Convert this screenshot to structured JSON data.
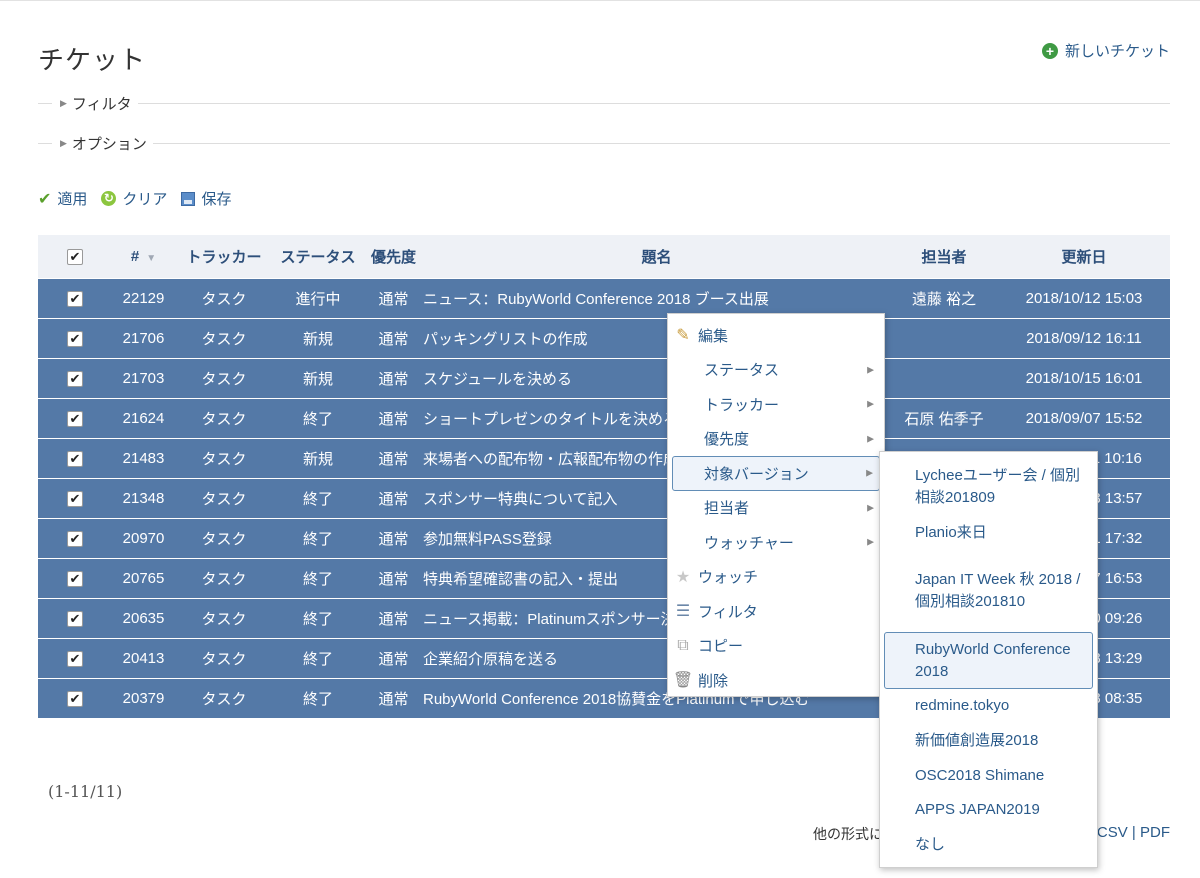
{
  "page": {
    "title": "チケット",
    "new_issue": "新しいチケット",
    "filter_label": "フィルタ",
    "options_label": "オプション"
  },
  "actions": {
    "apply": "適用",
    "clear": "クリア",
    "save": "保存"
  },
  "table": {
    "headers": [
      "#",
      "トラッカー",
      "ステータス",
      "優先度",
      "題名",
      "担当者",
      "更新日"
    ],
    "rows": [
      {
        "id": "22129",
        "tracker": "タスク",
        "status": "進行中",
        "priority": "通常",
        "subject": "ニュース：RubyWorld Conference 2018 ブース出展",
        "assignee": "遠藤 裕之",
        "updated": "2018/10/12 15:03"
      },
      {
        "id": "21706",
        "tracker": "タスク",
        "status": "新規",
        "priority": "通常",
        "subject": "パッキングリストの作成",
        "assignee": "",
        "updated": "2018/09/12 16:11"
      },
      {
        "id": "21703",
        "tracker": "タスク",
        "status": "新規",
        "priority": "通常",
        "subject": "スケジュールを決める",
        "assignee": "",
        "updated": "2018/10/15 16:01"
      },
      {
        "id": "21624",
        "tracker": "タスク",
        "status": "終了",
        "priority": "通常",
        "subject": "ショートプレゼンのタイトルを決める",
        "assignee": "石原 佑季子",
        "updated": "2018/09/07 15:52"
      },
      {
        "id": "21483",
        "tracker": "タスク",
        "status": "新規",
        "priority": "通常",
        "subject": "来場者への配布物・広報配布物の作成",
        "assignee": "",
        "updated": "2018/10/11 10:16"
      },
      {
        "id": "21348",
        "tracker": "タスク",
        "status": "終了",
        "priority": "通常",
        "subject": "スポンサー特典について記入",
        "assignee": "",
        "updated": "2018/08/23 13:57"
      },
      {
        "id": "20970",
        "tracker": "タスク",
        "status": "終了",
        "priority": "通常",
        "subject": "参加無料PASS登録",
        "assignee": "",
        "updated": "2018/08/21 17:32"
      },
      {
        "id": "20765",
        "tracker": "タスク",
        "status": "終了",
        "priority": "通常",
        "subject": "特典希望確認書の記入・提出",
        "assignee": "",
        "updated": "2018/08/07 16:53"
      },
      {
        "id": "20635",
        "tracker": "タスク",
        "status": "終了",
        "priority": "通常",
        "subject": "ニュース掲載：Platinumスポンサー決定",
        "assignee": "",
        "updated": "2018/08/10 09:26"
      },
      {
        "id": "20413",
        "tracker": "タスク",
        "status": "終了",
        "priority": "通常",
        "subject": "企業紹介原稿を送る",
        "assignee": "",
        "updated": "2018/07/18 13:29"
      },
      {
        "id": "20379",
        "tracker": "タスク",
        "status": "終了",
        "priority": "通常",
        "subject": "RubyWorld Conference 2018協賛金をPlatinumで申し込む",
        "assignee": "",
        "updated": "2018/07/18 08:35"
      }
    ]
  },
  "footer": {
    "count": "(1-11/11)",
    "other_formats": "他の形式にエクスポート：",
    "csv": "CSV",
    "pdf": "PDF",
    "sep": " | "
  },
  "context_menu": {
    "edit": "編集",
    "status": "ステータス",
    "tracker": "トラッカー",
    "priority": "優先度",
    "target_version": "対象バージョン",
    "assignee": "担当者",
    "watcher": "ウォッチャー",
    "watch": "ウォッチ",
    "filter": "フィルタ",
    "copy": "コピー",
    "delete": "削除"
  },
  "version_submenu": [
    "Lycheeユーザー会 / 個別相談201809",
    "Planio来日",
    "Japan IT Week 秋 2018 / 個別相談201810",
    "RubyWorld Conference 2018",
    "redmine.tokyo",
    "新価値創造展2018",
    "OSC2018 Shimane",
    "APPS JAPAN2019",
    "なし"
  ],
  "colors": {
    "selected_row": "#5479a7",
    "header_bg": "#eef1f6",
    "link": "#2a5a8a",
    "highlight_border": "#628db6"
  }
}
